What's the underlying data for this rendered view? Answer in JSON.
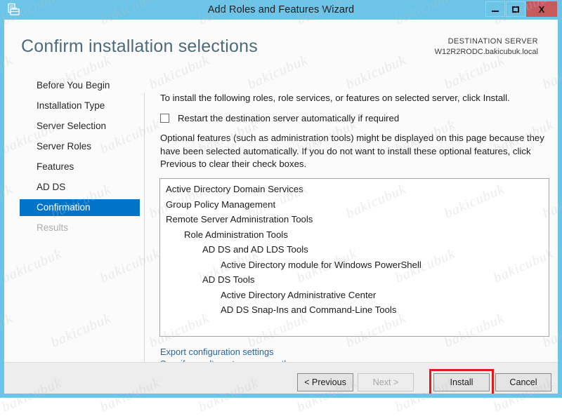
{
  "window": {
    "title": "Add Roles and Features Wizard",
    "icon": "server-manager-toolbox-icon",
    "minimize_label": "–",
    "maximize_label": "□",
    "close_label": "X",
    "frame_color": "#6cc4e8",
    "close_color": "#c75b5b"
  },
  "header": {
    "page_title": "Confirm installation selections",
    "destination_label": "DESTINATION SERVER",
    "destination_server": "W12R2RODC.bakicubuk.local",
    "title_color": "#4c6b7a"
  },
  "sidebar": {
    "selected_color": "#0174c8",
    "items": [
      {
        "label": "Before You Begin",
        "state": "normal"
      },
      {
        "label": "Installation Type",
        "state": "normal"
      },
      {
        "label": "Server Selection",
        "state": "normal"
      },
      {
        "label": "Server Roles",
        "state": "normal"
      },
      {
        "label": "Features",
        "state": "normal"
      },
      {
        "label": "AD DS",
        "state": "normal"
      },
      {
        "label": "Confirmation",
        "state": "selected"
      },
      {
        "label": "Results",
        "state": "disabled"
      }
    ]
  },
  "main": {
    "intro": "To install the following roles, role services, or features on selected server, click Install.",
    "restart_checkbox": {
      "label": "Restart the destination server automatically if required",
      "checked": false
    },
    "optional_note": "Optional features (such as administration tools) might be displayed on this page because they have been selected automatically. If you do not want to install these optional features, click Previous to clear their check boxes.",
    "feature_list": [
      {
        "label": "Active Directory Domain Services",
        "indent": 0
      },
      {
        "label": "Group Policy Management",
        "indent": 0
      },
      {
        "label": "Remote Server Administration Tools",
        "indent": 0
      },
      {
        "label": "Role Administration Tools",
        "indent": 1
      },
      {
        "label": "AD DS and AD LDS Tools",
        "indent": 2
      },
      {
        "label": "Active Directory module for Windows PowerShell",
        "indent": 3
      },
      {
        "label": "AD DS Tools",
        "indent": 2
      },
      {
        "label": "Active Directory Administrative Center",
        "indent": 3
      },
      {
        "label": "AD DS Snap-Ins and Command-Line Tools",
        "indent": 3
      }
    ],
    "links": [
      {
        "label": "Export configuration settings"
      },
      {
        "label": "Specify an alternate source path"
      }
    ],
    "link_color": "#2a6496"
  },
  "footer": {
    "previous_label": "< Previous",
    "next_label": "Next >",
    "install_label": "Install",
    "cancel_label": "Cancel",
    "next_disabled": true,
    "highlight_color": "#e01b1b",
    "highlighted_button": "Install"
  },
  "watermark": {
    "text": "bakicubuk"
  }
}
